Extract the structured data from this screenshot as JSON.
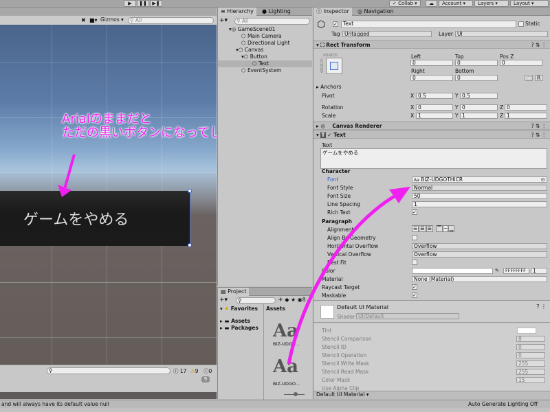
{
  "toolbar": {
    "collab": "Collab",
    "account": "Account",
    "layers": "Layers",
    "layout": "Layout"
  },
  "scene": {
    "gizmos": "Gizmos",
    "search_placeholder": "All",
    "button_text": "ゲームをやめる",
    "annotation_line1": "Arialのままだと",
    "annotation_line2": "ただの黒いボタンになってしまう",
    "console_count_warn": "9",
    "console_count_log": "17",
    "console_count_err": "0",
    "console_badge": "9"
  },
  "status_text": "and will always have its default value null",
  "status_right": "Auto Generate Lighting Off",
  "hierarchy": {
    "tab_hierarchy": "Hierarchy",
    "tab_lighting": "Lighting",
    "search_placeholder": "All",
    "items": [
      "GameScene01",
      "Main Camera",
      "Directional Light",
      "Canvas",
      "Button",
      "Text",
      "EventSystem"
    ]
  },
  "project": {
    "tab": "Project",
    "favorites": "Favorites",
    "assets": "Assets",
    "packages": "Packages",
    "assets_header": "Assets",
    "asset1": "BIZ-UDGO...",
    "asset2": "BIZ-UDGO..."
  },
  "inspector": {
    "tab_inspector": "Inspector",
    "tab_navigation": "Navigation",
    "object_name": "Text",
    "static": "Static",
    "tag_label": "Tag",
    "tag_value": "Untagged",
    "layer_label": "Layer",
    "layer_value": "UI",
    "rect_transform": "Rect Transform",
    "stretch": "stretch",
    "stretch_v": "stretch",
    "left": "Left",
    "top": "Top",
    "posz": "Pos Z",
    "left_v": "0",
    "top_v": "0",
    "posz_v": "0",
    "right": "Right",
    "bottom": "Bottom",
    "right_v": "0",
    "bottom_v": "0",
    "btn_r": "R",
    "anchors": "Anchors",
    "pivot": "Pivot",
    "pivot_x": "0.5",
    "pivot_y": "0.5",
    "rotation": "Rotation",
    "rot_x": "0",
    "rot_y": "0",
    "rot_z": "0",
    "scale": "Scale",
    "sc_x": "1",
    "sc_y": "1",
    "sc_z": "1",
    "canvas_renderer": "Canvas Renderer",
    "text_comp": "Text",
    "text_label": "Text",
    "text_value": "ゲームをやめる",
    "character": "Character",
    "font": "Font",
    "font_value": "BIZ-UDGOTHICR",
    "font_style": "Font Style",
    "font_style_value": "Normal",
    "font_size": "Font Size",
    "font_size_value": "50",
    "line_spacing": "Line Spacing",
    "line_spacing_value": "1",
    "rich_text": "Rich Text",
    "paragraph": "Paragraph",
    "alignment": "Alignment",
    "align_by_geometry": "Align By Geometry",
    "h_overflow": "Horizontal Overflow",
    "h_overflow_value": "Overflow",
    "v_overflow": "Vertical Overflow",
    "v_overflow_value": "Overflow",
    "best_fit": "Best Fit",
    "color": "Color",
    "color_hex": "FFFFFFFF",
    "color_alpha": "1",
    "material": "Material",
    "material_value": "None (Material)",
    "raycast_target": "Raycast Target",
    "maskable": "Maskable",
    "mat_name": "Default UI Material",
    "shader": "Shader",
    "shader_value": "UI/Default",
    "tint": "Tint",
    "stencil_comparison": "Stencil Comparison",
    "stencil_comparison_v": "8",
    "stencil_id": "Stencil ID",
    "stencil_id_v": "0",
    "stencil_operation": "Stencil Operation",
    "stencil_operation_v": "0",
    "stencil_write": "Stencil Write Mask",
    "stencil_write_v": "255",
    "stencil_read": "Stencil Read Mask",
    "stencil_read_v": "255",
    "color_mask": "Color Mask",
    "color_mask_v": "15",
    "use_alpha_clip": "Use Alpha Clip",
    "footer": "Default UI Material"
  },
  "colors": {
    "annotation": "#f020f0",
    "selection": "#3d6fd6"
  }
}
